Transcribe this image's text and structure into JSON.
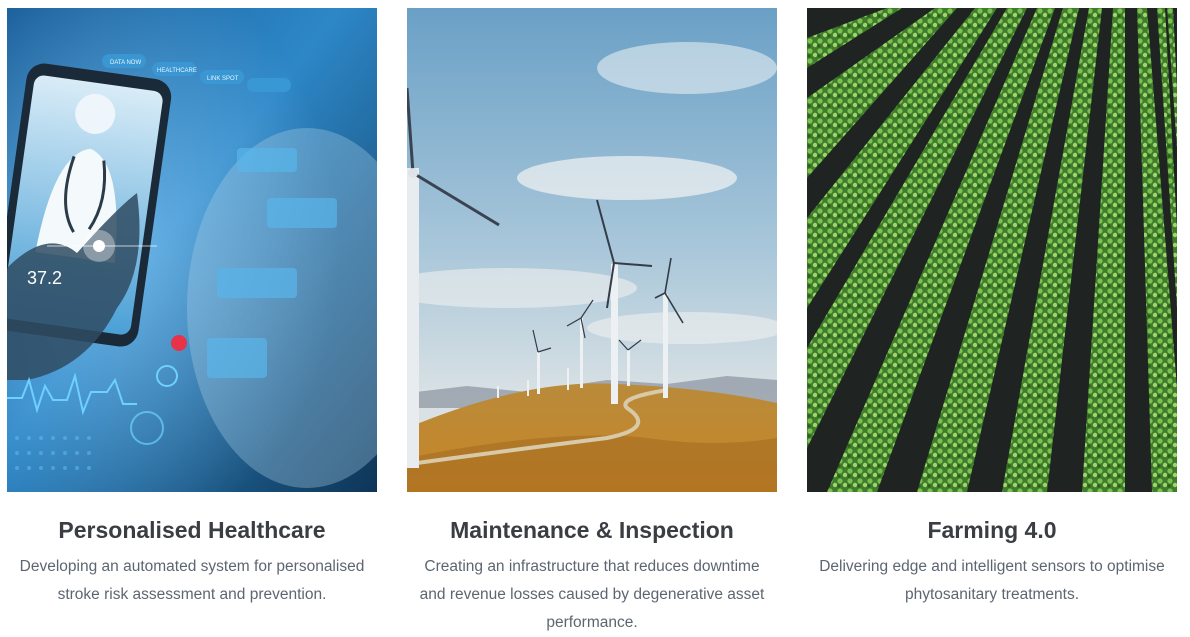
{
  "cards": [
    {
      "image": "healthcare-tablet-photo",
      "title": "Personalised Healthcare",
      "description": "Developing an automated system for personalised stroke risk assessment and prevention.",
      "image_text": [
        "37.2",
        "DATA NOW",
        "HEALTHCARE",
        "LINK SPOT"
      ]
    },
    {
      "image": "wind-turbines-photo",
      "title": "Maintenance & Inspection",
      "description": "Creating an infrastructure that reduces downtime and revenue losses caused by degenerative asset performance."
    },
    {
      "image": "crop-field-rows-photo",
      "title": "Farming 4.0",
      "description": "Delivering edge and intelligent sensors to optimise phytosanitary treatments."
    }
  ]
}
